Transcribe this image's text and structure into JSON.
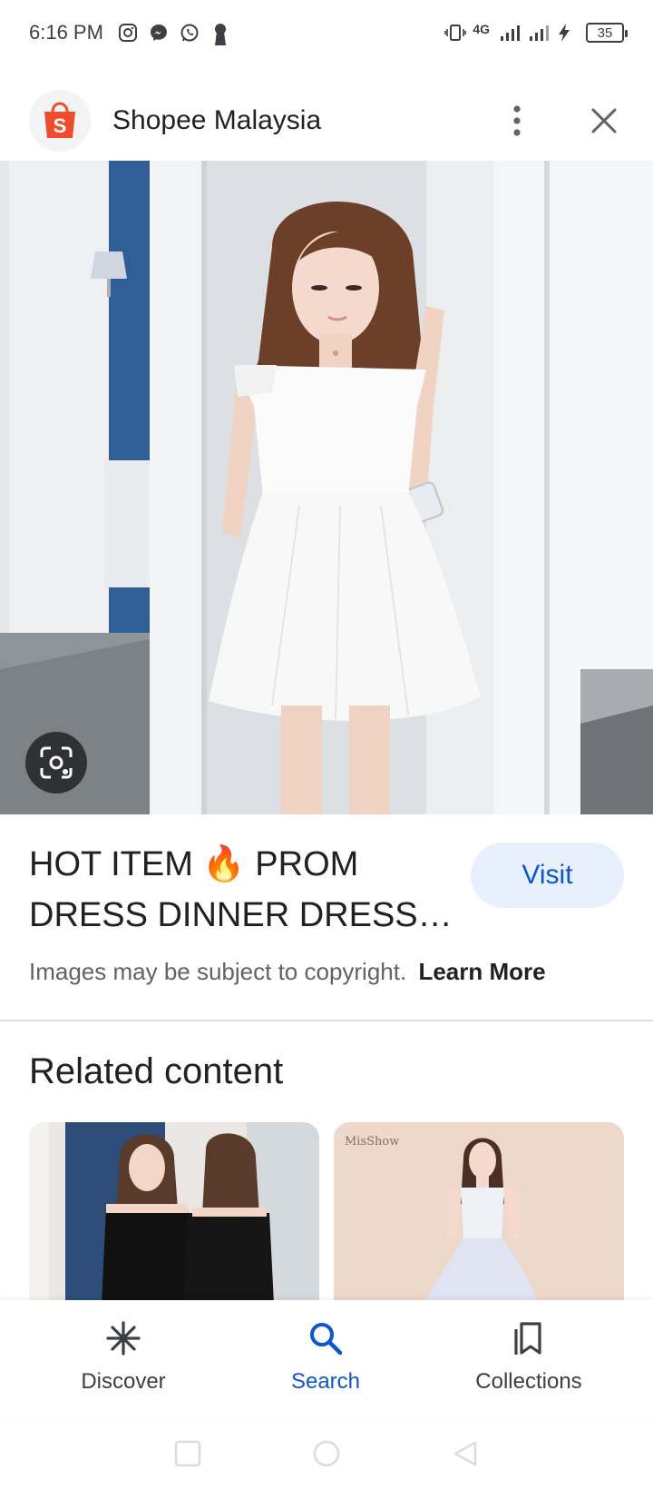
{
  "status_bar": {
    "time": "6:16 PM",
    "network": "4G",
    "battery": "35",
    "icons": [
      "instagram-icon",
      "messenger-icon",
      "whatsapp-icon",
      "keyhole-icon",
      "vibrate-icon",
      "signal-icon",
      "charging-icon"
    ]
  },
  "header": {
    "title": "Shopee Malaysia",
    "logo_letter": "S",
    "logo_color": "#ee4d2d"
  },
  "result": {
    "title": "HOT ITEM 🔥 PROM DRESS DINNER DRESS WHITE DRESS",
    "visit_label": "Visit",
    "copyright_text": "Images may be subject to copyright.",
    "learn_more_label": "Learn More"
  },
  "related": {
    "heading": "Related content",
    "thumb_2_label": "MisShow"
  },
  "bottom_nav": {
    "items": [
      {
        "label": "Discover",
        "icon": "asterisk-icon",
        "active": false
      },
      {
        "label": "Search",
        "icon": "search-icon",
        "active": true
      },
      {
        "label": "Collections",
        "icon": "bookmarks-icon",
        "active": false
      }
    ]
  },
  "colors": {
    "accent": "#0b57d0",
    "visit_bg": "#e8f0fe",
    "shopee": "#ee4d2d"
  }
}
